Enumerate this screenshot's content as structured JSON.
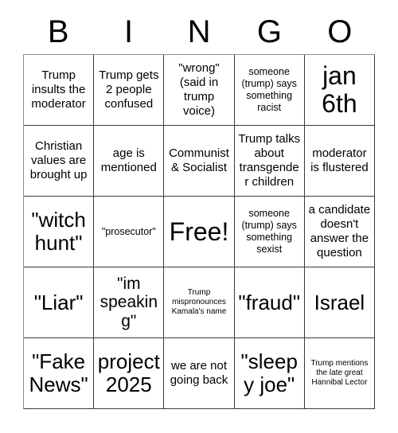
{
  "card": {
    "header_letters": [
      "B",
      "I",
      "N",
      "G",
      "O"
    ],
    "rows": [
      [
        {
          "text": "Trump insults the moderator",
          "size": "md"
        },
        {
          "text": "Trump gets 2 people confused",
          "size": "md"
        },
        {
          "text": "\"wrong\" (said in trump voice)",
          "size": "md"
        },
        {
          "text": "someone (trump) says something racist",
          "size": "sm"
        },
        {
          "text": "jan 6th",
          "size": "xxl"
        }
      ],
      [
        {
          "text": "Christian values are brought up",
          "size": "md"
        },
        {
          "text": "age is mentioned",
          "size": "md"
        },
        {
          "text": "Communist & Socialist",
          "size": "md"
        },
        {
          "text": "Trump talks about transgender children",
          "size": "md"
        },
        {
          "text": "moderator is flustered",
          "size": "md"
        }
      ],
      [
        {
          "text": "\"witch hunt\"",
          "size": "xl"
        },
        {
          "text": "\"prosecutor\"",
          "size": "sm"
        },
        {
          "text": "Free!",
          "size": "xxl"
        },
        {
          "text": "someone (trump) says something sexist",
          "size": "sm"
        },
        {
          "text": "a candidate doesn't answer the question",
          "size": "md"
        }
      ],
      [
        {
          "text": "\"Liar\"",
          "size": "xl"
        },
        {
          "text": "\"im speaking\"",
          "size": "lg"
        },
        {
          "text": "Trump mispronounces Kamala's name",
          "size": "xs"
        },
        {
          "text": "\"fraud\"",
          "size": "xl"
        },
        {
          "text": "Israel",
          "size": "xl"
        }
      ],
      [
        {
          "text": "\"Fake News\"",
          "size": "xl"
        },
        {
          "text": "project 2025",
          "size": "xl"
        },
        {
          "text": "we are not going back",
          "size": "md"
        },
        {
          "text": "\"sleepy joe\"",
          "size": "xl"
        },
        {
          "text": "Trump mentions the late great Hannibal Lector",
          "size": "xs"
        }
      ]
    ]
  },
  "colors": {
    "background": "#ffffff",
    "text": "#000000",
    "grid_line": "#3a3a3a",
    "grid_outer_line": "#8c8c8c"
  }
}
